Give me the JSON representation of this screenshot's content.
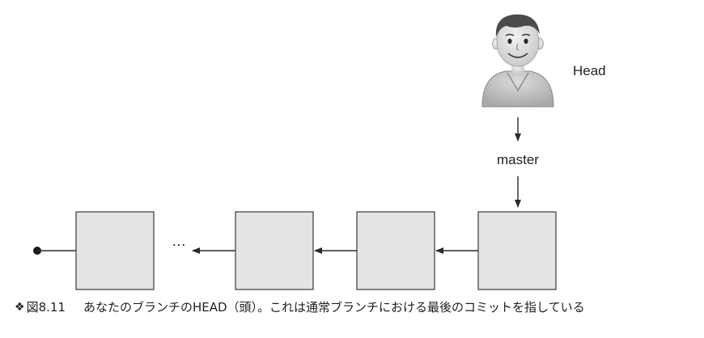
{
  "head_label": "Head",
  "branch_label": "master",
  "ellipsis": "…",
  "caption": {
    "mark": "❖",
    "number": "図8.11",
    "text": "あなたのブランチのHEAD（頭）。これは通常ブランチにおける最後のコミットを指している"
  },
  "colors": {
    "box_fill": "#e4e4e4",
    "box_stroke": "#3a3a3a",
    "line": "#2a2a2a",
    "avatar_body": "#c9c9c9",
    "avatar_skin": "#e2e2e2",
    "avatar_hair": "#4a4a4a"
  },
  "icons": {
    "head": "person-avatar-icon",
    "start": "filled-dot-icon"
  }
}
